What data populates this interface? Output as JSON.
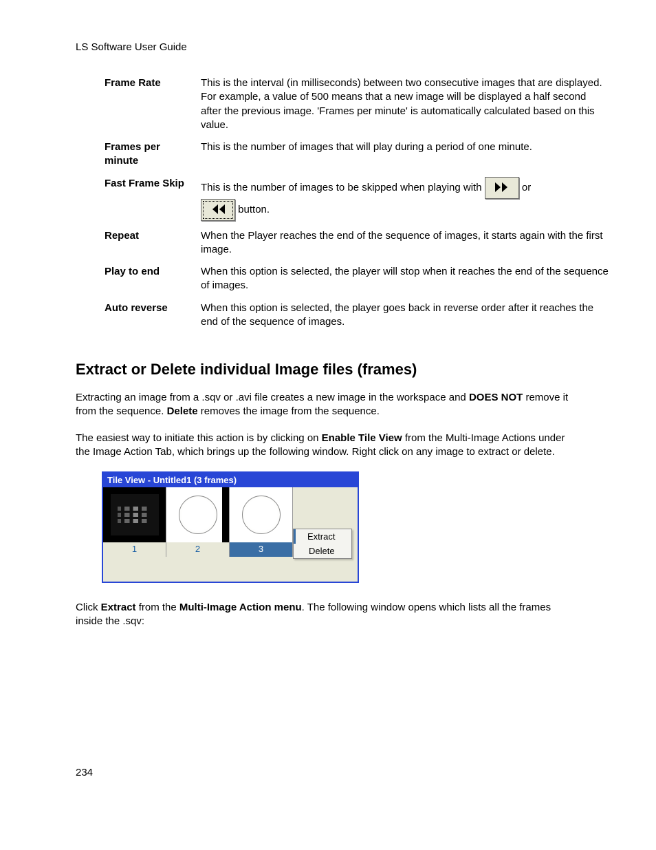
{
  "header": "LS Software User Guide",
  "definitions": [
    {
      "term": "Frame Rate",
      "desc": "This is the interval (in milliseconds) between two consecutive images that are displayed. For example, a value of 500 means that a new image will be displayed a half second after the previous image. 'Frames per minute' is automatically calculated based on this value."
    },
    {
      "term": "Frames per minute",
      "desc": "This is the number of images that will play during a period of one minute."
    },
    {
      "term": "Fast Frame Skip",
      "desc_pre": "This is the number of images to be skipped when playing with ",
      "desc_mid": " or ",
      "desc_post": " button."
    },
    {
      "term": "Repeat",
      "desc": "When the Player reaches the end of the sequence of images, it starts again with the first image."
    },
    {
      "term": "Play to end",
      "desc": "When this option is selected, the player will stop when it reaches the end of the sequence of images."
    },
    {
      "term": "Auto reverse",
      "desc": "When this option is selected, the player goes back in reverse order after it reaches the end of the sequence of images."
    }
  ],
  "section_heading": "Extract or Delete individual Image files (frames)",
  "para1": {
    "t1": "Extracting an image from a .sqv or .avi file creates a new image in the workspace and ",
    "b1": "DOES NOT",
    "t2": " remove it from the sequence. ",
    "b2": "Delete",
    "t3": " removes the image from the sequence."
  },
  "para2": {
    "t1": "The easiest way to initiate this action is by clicking on ",
    "b1": "Enable Tile View",
    "t2": " from the Multi-Image Actions under the Image Action Tab, which brings up the following window. Right click on any image to extract or delete."
  },
  "tileview": {
    "title": "Tile View - Untitled1 (3 frames)",
    "thumbs": [
      "1",
      "2",
      "3"
    ],
    "ctx": [
      "Extract",
      "Delete"
    ]
  },
  "para3": {
    "t1": "Click ",
    "b1": "Extract",
    "t2": " from the ",
    "b2": "Multi-Image Action menu",
    "t3": ". The following window opens which lists all the frames inside the .sqv:"
  },
  "page_number": "234"
}
